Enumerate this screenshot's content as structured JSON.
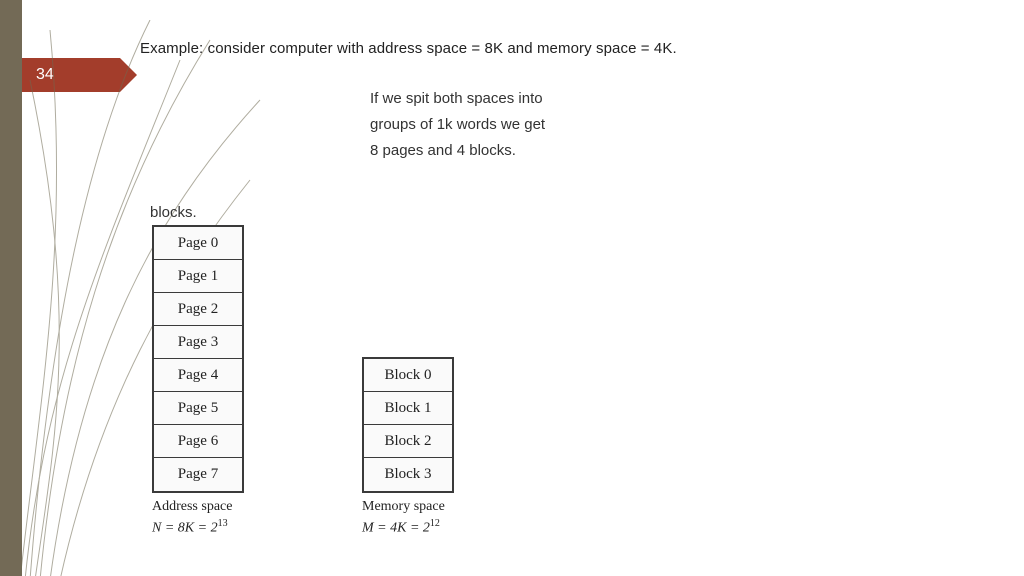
{
  "slide_number": "34",
  "heading": "Example: consider computer with address space =  8K and memory space = 4K.",
  "body_lines": [
    "If we spit both spaces into",
    "groups of 1k words we get",
    "8 pages and 4 blocks."
  ],
  "blocks_label": "blocks.",
  "pages": [
    "Page 0",
    "Page 1",
    "Page 2",
    "Page 3",
    "Page 4",
    "Page 5",
    "Page 6",
    "Page 7"
  ],
  "blocks": [
    "Block 0",
    "Block 1",
    "Block 2",
    "Block 3"
  ],
  "address_caption_line1": "Address space",
  "address_caption_line2_prefix": "N = 8K = 2",
  "address_caption_line2_sup": "13",
  "memory_caption_line1": "Memory space",
  "memory_caption_line2_prefix": "M = 4K = 2",
  "memory_caption_line2_sup": "12",
  "colors": {
    "edge": "#736a56",
    "tag": "#a33d2b"
  }
}
